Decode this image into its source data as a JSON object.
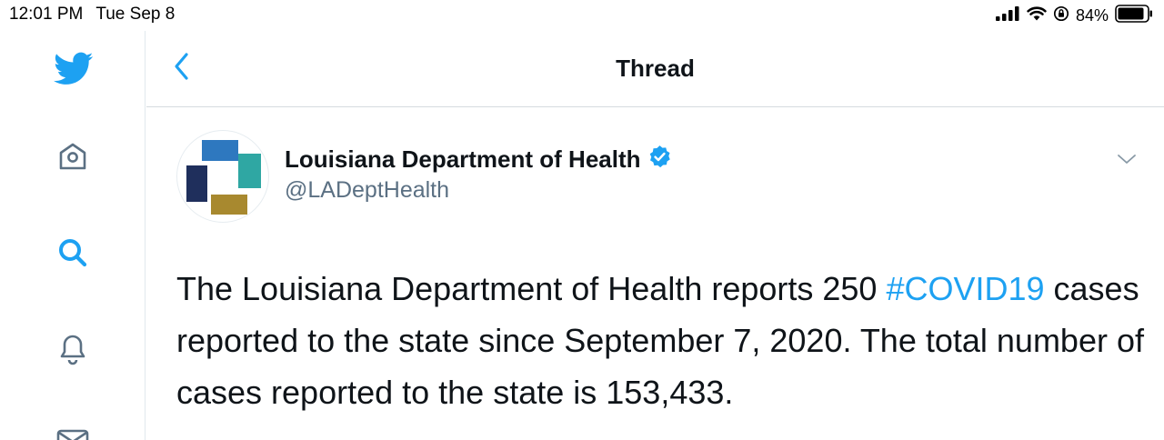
{
  "status_bar": {
    "time": "12:01 PM",
    "date": "Tue Sep 8",
    "battery_percent": "84%",
    "icons": [
      "signal-icon",
      "wifi-icon",
      "orientation-lock-icon",
      "battery-icon"
    ]
  },
  "sidebar": {
    "items": [
      {
        "name": "twitter-logo-icon",
        "active": false
      },
      {
        "name": "home-icon",
        "active": false
      },
      {
        "name": "search-icon",
        "active": true
      },
      {
        "name": "notifications-bell-icon",
        "active": false
      },
      {
        "name": "messages-icon",
        "active": false
      }
    ]
  },
  "header": {
    "title": "Thread"
  },
  "tweet": {
    "author": {
      "name": "Louisiana Department of Health",
      "handle": "@LADeptHealth",
      "verified": true
    },
    "text_before": "The Louisiana Department of Health reports 250 ",
    "hashtag": "#COVID19",
    "text_after": " cases reported to the state since September 7, 2020. The total number of cases reported to the state is 153,433."
  },
  "colors": {
    "accent": "#1da1f2",
    "text": "#0f1419",
    "secondary_text": "#5b7083",
    "logo_blue": "#2e78bf",
    "logo_teal": "#2fa7a3",
    "logo_navy": "#1f2f5c",
    "logo_gold": "#a8892f"
  }
}
